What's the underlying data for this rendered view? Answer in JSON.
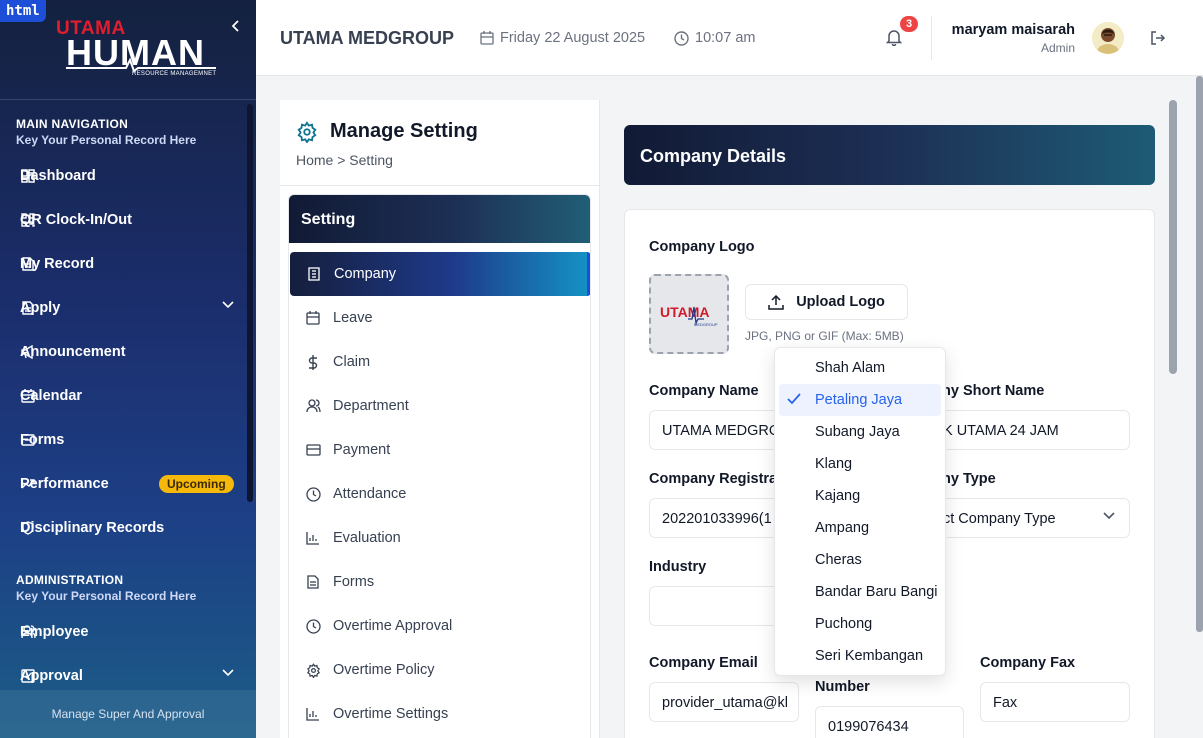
{
  "sidebar": {
    "html_tag": "html",
    "logo": {
      "utama": "UTAMA",
      "human": "HUMAN",
      "sub": "RESOURCE MANAGEMNET"
    },
    "main_nav": {
      "title": "MAIN NAVIGATION",
      "subtitle": "Key Your Personal Record Here",
      "items": [
        {
          "label": "Dashboard",
          "icon": "dashboard-icon"
        },
        {
          "label": "QR Clock-In/Out",
          "icon": "qr-icon"
        },
        {
          "label": "My Record",
          "icon": "document-icon"
        },
        {
          "label": "Apply",
          "icon": "document-icon"
        },
        {
          "label": "Announcement",
          "icon": "megaphone-icon"
        },
        {
          "label": "Calendar",
          "icon": "calendar-icon"
        },
        {
          "label": "Forms",
          "icon": "forms-icon"
        },
        {
          "label": "Performance",
          "icon": "trend-icon",
          "badge": "Upcoming"
        },
        {
          "label": "Disciplinary Records",
          "icon": "shield-icon"
        }
      ]
    },
    "admin": {
      "title": "ADMINISTRATION",
      "subtitle": "Key Your Personal Record Here",
      "items": [
        {
          "label": "Employee",
          "icon": "users-icon"
        },
        {
          "label": "Approval",
          "icon": "check-square-icon"
        }
      ]
    },
    "footer": "Manage Super And Approval"
  },
  "header": {
    "company": "UTAMA MEDGROUP",
    "date": "Friday 22 August 2025",
    "time": "10:07 am",
    "notifications": "3",
    "user_name": "maryam maisarah",
    "user_role": "Admin"
  },
  "settings": {
    "title": "Manage Setting",
    "breadcrumb": "Home > Setting",
    "box_title": "Setting",
    "menu": [
      {
        "label": "Company",
        "icon": "building-icon"
      },
      {
        "label": "Leave",
        "icon": "calendar-icon"
      },
      {
        "label": "Claim",
        "icon": "dollar-icon"
      },
      {
        "label": "Department",
        "icon": "users-icon"
      },
      {
        "label": "Payment",
        "icon": "credit-card-icon"
      },
      {
        "label": "Attendance",
        "icon": "clock-icon"
      },
      {
        "label": "Evaluation",
        "icon": "bar-chart-icon"
      },
      {
        "label": "Forms",
        "icon": "document-icon"
      },
      {
        "label": "Overtime Approval",
        "icon": "clock-icon"
      },
      {
        "label": "Overtime Policy",
        "icon": "gear-icon"
      },
      {
        "label": "Overtime Settings",
        "icon": "bar-chart-icon"
      }
    ]
  },
  "company": {
    "section_title": "Company Details",
    "logo_label": "Company Logo",
    "logo_text": "UTAMA",
    "logo_sub": "MEDGROUP",
    "upload_label": "Upload Logo",
    "upload_hint": "JPG, PNG or GIF (Max: 5MB)",
    "name_label": "Company Name",
    "name_value": "UTAMA MEDGRO",
    "short_name_label": "ny Short Name",
    "short_name_value": "K UTAMA 24 JAM",
    "reg_label": "Company Registrat",
    "reg_value": "202201033996(1",
    "type_label": "ny Type",
    "type_value": "ct Company Type",
    "industry_label": "Industry",
    "email_label": "Company Email",
    "email_value": "provider_utama@kl",
    "phone_label": "Number",
    "phone_value": "0199076434",
    "fax_label": "Company Fax",
    "fax_value": "Fax"
  },
  "dropdown": {
    "options": [
      "Shah Alam",
      "Petaling Jaya",
      "Subang Jaya",
      "Klang",
      "Kajang",
      "Ampang",
      "Cheras",
      "Bandar Baru Bangi",
      "Puchong",
      "Seri Kembangan"
    ],
    "selected": "Petaling Jaya"
  },
  "colors": {
    "accent": "#2563eb",
    "badge": "#f5b80b",
    "notify": "#ef4444",
    "teal": "#0e7490"
  }
}
